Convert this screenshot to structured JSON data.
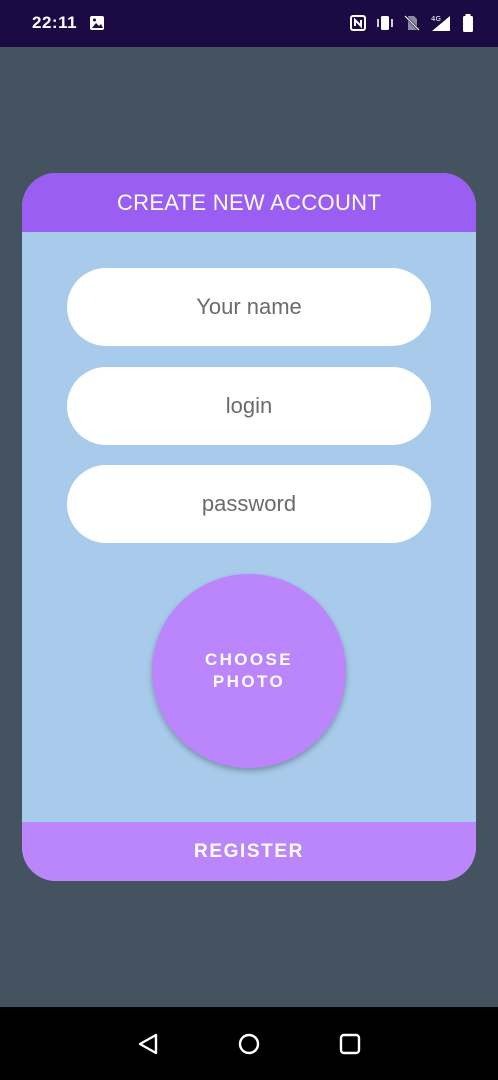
{
  "status_bar": {
    "time": "22:11",
    "icons": [
      "image-icon",
      "nfc-icon",
      "vibrate-icon",
      "no-sim-icon",
      "signal-4g-icon",
      "battery-icon"
    ],
    "network_label": "4G"
  },
  "card": {
    "title": "CREATE NEW ACCOUNT",
    "fields": {
      "name_placeholder": "Your name",
      "login_placeholder": "login",
      "password_placeholder": "password"
    },
    "photo_button_label": "CHOOSE PHOTO",
    "register_label": "REGISTER"
  },
  "nav_bar": {
    "icons": [
      "back-icon",
      "home-icon",
      "recents-icon"
    ]
  },
  "colors": {
    "status_bar_bg": "#1c0a45",
    "background": "#45525f",
    "card_body": "#a8cbeb",
    "header_purple": "#9b5ef2",
    "accent_purple": "#bb86fc",
    "field_bg": "#ffffff"
  }
}
